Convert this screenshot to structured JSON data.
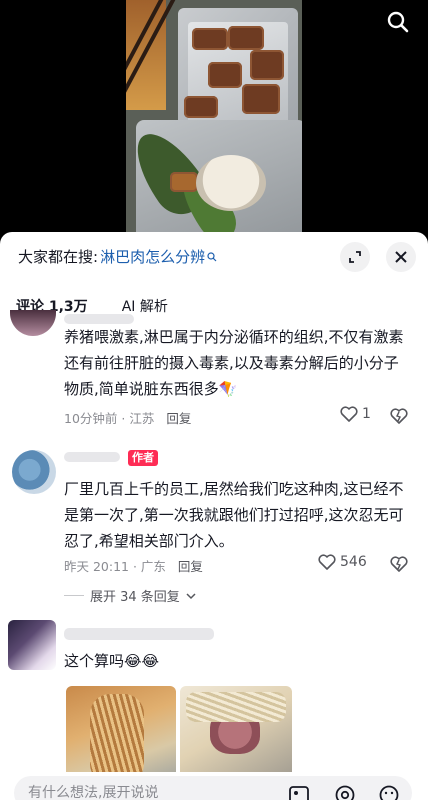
{
  "search_hint": {
    "label": "大家都在搜:",
    "term": "淋巴肉怎么分辨"
  },
  "tabs": {
    "comments": "评论 1,3万",
    "ai": "AI 解析"
  },
  "comments": [
    {
      "text": "养猪喂激素,淋巴属于内分泌循环的组织,不仅有激素还有前往肝脏的摄入毒素,以及毒素分解后的小分子物质,简单说脏东西很多",
      "emoji": "🪁",
      "time": "10分钟前 · 江苏",
      "reply": "回复",
      "likes": "1"
    },
    {
      "tag": "作者",
      "text": "厂里几百上千的员工,居然给我们吃这种肉,这已经不是第一次了,第一次我就跟他们打过招呼,这次忍无可忍了,希望相关部门介入。",
      "time": "昨天 20:11 · 广东",
      "reply": "回复",
      "likes": "546",
      "expand": "展开 34 条回复"
    },
    {
      "text": "这个算吗",
      "emoji": "😂😂"
    }
  ],
  "input": {
    "placeholder": "有什么想法,展开说说"
  },
  "colors": {
    "accent_link": "#1d5fae",
    "author_tag": "#fe2c55",
    "meta_gray": "#8a8b91"
  },
  "icons": [
    "search-icon",
    "minimize-icon",
    "close-icon",
    "heart-icon",
    "dislike-icon",
    "chevron-down-icon",
    "image-icon",
    "mention-icon",
    "emoji-icon"
  ]
}
